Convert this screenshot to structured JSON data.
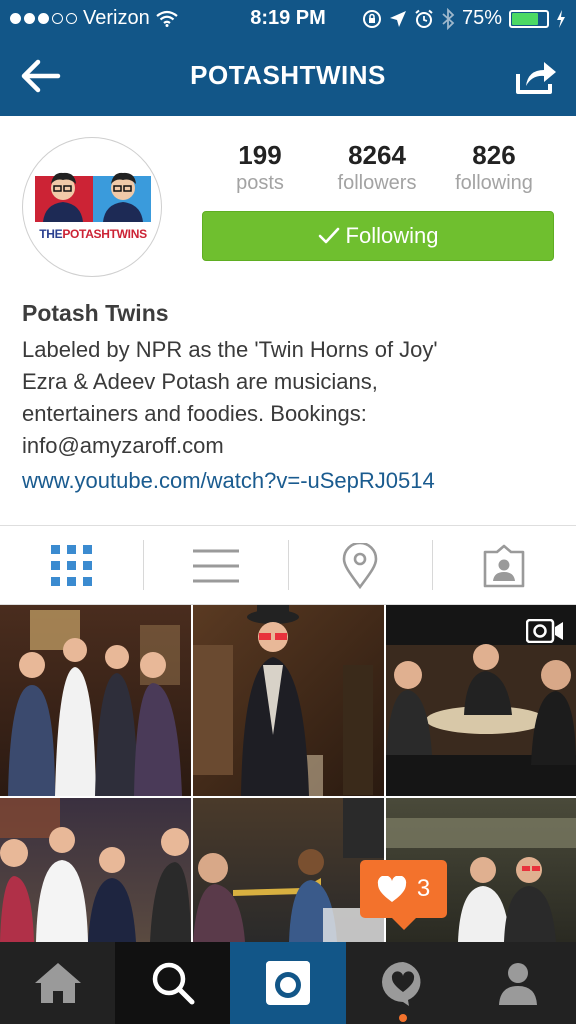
{
  "status": {
    "carrier": "Verizon",
    "time": "8:19 PM",
    "battery": "75%",
    "battery_level": 0.75,
    "signal_bars": 3,
    "signal_total": 5
  },
  "nav": {
    "title": "POTASHTWINS"
  },
  "avatar": {
    "wordmark_left": "THE",
    "wordmark_right": "POTASHTWINS"
  },
  "stats": [
    {
      "value": "199",
      "label": "posts"
    },
    {
      "value": "8264",
      "label": "followers"
    },
    {
      "value": "826",
      "label": "following"
    }
  ],
  "follow_button": {
    "label": "Following",
    "color": "#6fbf2f"
  },
  "bio": {
    "name": "Potash Twins",
    "lines": [
      "Labeled by NPR as the 'Twin Horns of Joy'",
      "Ezra & Adeev Potash are musicians,",
      "entertainers and foodies. Bookings:",
      "info@amyzaroff.com"
    ],
    "link": "www.youtube.com/watch?v=-uSepRJ0514"
  },
  "tabs": [
    {
      "icon": "grid-icon",
      "active": true
    },
    {
      "icon": "list-icon",
      "active": false
    },
    {
      "icon": "location-pin-icon",
      "active": false
    },
    {
      "icon": "tagged-person-icon",
      "active": false
    }
  ],
  "notification": {
    "count": "3",
    "icon": "heart-icon"
  },
  "bottom_nav": [
    {
      "icon": "home-icon"
    },
    {
      "icon": "search-icon"
    },
    {
      "icon": "camera-icon"
    },
    {
      "icon": "activity-icon"
    },
    {
      "icon": "profile-icon"
    }
  ],
  "colors": {
    "brand": "#125688",
    "accent_link": "#1a5b8f",
    "notification": "#f3722c",
    "tab_active": "#3b8bd0"
  }
}
